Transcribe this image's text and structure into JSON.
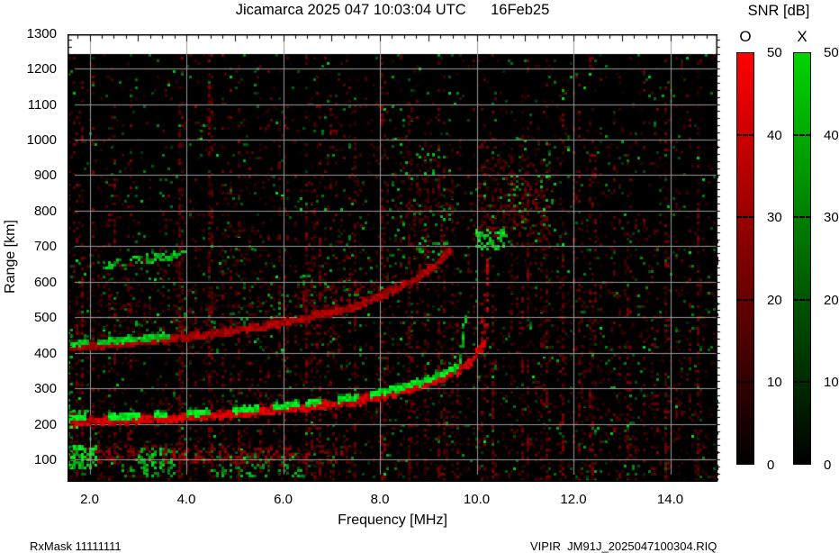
{
  "title": "Jicamarca 2025 047 10:03:04 UTC      16Feb25",
  "footer": {
    "left": "RxMask 11111111",
    "right": "VIPIR  JM91J_2025047100304.RIQ"
  },
  "colorbar": {
    "title": "SNR [dB]",
    "tick_values": [
      0,
      10,
      20,
      30,
      40,
      50
    ],
    "tick_labels": [
      "0",
      "10",
      "20",
      "30",
      "40",
      "50"
    ],
    "bars": [
      {
        "label": "O",
        "top_color": "#ff0000",
        "bottom_color": "#000000"
      },
      {
        "label": "X",
        "top_color": "#00d400",
        "bottom_color": "#000000"
      }
    ]
  },
  "chart_data": {
    "type": "heatmap",
    "title": "Jicamarca 2025 047 10:03:04 UTC      16Feb25",
    "xlabel": "Frequency [MHz]",
    "ylabel": "Range [km]",
    "xlim": [
      1.5,
      15.0
    ],
    "ylim": [
      40,
      1300
    ],
    "grid": true,
    "grid_color": "#9a9a9a",
    "x_tick_values": [
      2,
      4,
      6,
      8,
      10,
      12,
      14
    ],
    "x_tick_labels": [
      "2.0",
      "4.0",
      "6.0",
      "8.0",
      "10.0",
      "12.0",
      "14.0"
    ],
    "y_tick_values": [
      100,
      200,
      300,
      400,
      500,
      600,
      700,
      800,
      900,
      1000,
      1100,
      1200,
      1300
    ],
    "y_tick_labels": [
      "100",
      "200",
      "300",
      "400",
      "500",
      "600",
      "700",
      "800",
      "900",
      "1000",
      "1100",
      "1200",
      "1300"
    ],
    "snr_scale_db": [
      0,
      50
    ],
    "modes": {
      "O": "red",
      "X": "green"
    },
    "data_max_range_km": 1240,
    "traces": [
      {
        "name": "F2 main echo O-mode",
        "mode": "O",
        "thickness_km": 17,
        "brightness": 1.0,
        "points": [
          [
            1.5,
            205
          ],
          [
            2.5,
            210
          ],
          [
            3.5,
            216
          ],
          [
            4.5,
            223
          ],
          [
            5.5,
            234
          ],
          [
            6.5,
            248
          ],
          [
            7.5,
            264
          ],
          [
            8.2,
            284
          ],
          [
            8.8,
            306
          ],
          [
            9.2,
            325
          ],
          [
            9.6,
            350
          ],
          [
            9.9,
            378
          ],
          [
            10.05,
            405
          ],
          [
            10.18,
            438
          ]
        ],
        "segments": [
          [
            1.5,
            10.18
          ]
        ]
      },
      {
        "name": "F2 main echo X-mode",
        "mode": "X",
        "thickness_km": 12,
        "brightness": 1.0,
        "offset_km": 11,
        "points": [
          [
            1.5,
            205
          ],
          [
            2.5,
            210
          ],
          [
            3.5,
            216
          ],
          [
            4.5,
            223
          ],
          [
            5.5,
            234
          ],
          [
            6.5,
            248
          ],
          [
            7.5,
            264
          ],
          [
            8.2,
            284
          ],
          [
            8.8,
            306
          ],
          [
            9.2,
            325
          ],
          [
            9.6,
            350
          ],
          [
            9.9,
            378
          ]
        ],
        "segments": [
          [
            1.5,
            1.95
          ],
          [
            2.4,
            3.05
          ],
          [
            3.35,
            3.62
          ],
          [
            4.05,
            4.5
          ],
          [
            4.95,
            5.5
          ],
          [
            5.8,
            6.32
          ],
          [
            6.5,
            6.78
          ],
          [
            7.15,
            7.55
          ],
          [
            7.8,
            9.62
          ]
        ]
      },
      {
        "name": "2F second-hop echo O-mode",
        "mode": "O",
        "thickness_km": 15,
        "brightness": 0.8,
        "points": [
          [
            1.5,
            415
          ],
          [
            2.5,
            424
          ],
          [
            3.5,
            436
          ],
          [
            4.5,
            452
          ],
          [
            5.5,
            472
          ],
          [
            6.5,
            498
          ],
          [
            7.5,
            530
          ],
          [
            8.2,
            570
          ],
          [
            8.8,
            614
          ],
          [
            9.2,
            652
          ],
          [
            9.45,
            688
          ]
        ],
        "segments": [
          [
            1.5,
            9.45
          ]
        ]
      },
      {
        "name": "2F second-hop echo X-mode",
        "mode": "X",
        "thickness_km": 11,
        "brightness": 0.9,
        "offset_km": 10,
        "points": [
          [
            1.5,
            415
          ],
          [
            2.5,
            424
          ],
          [
            3.5,
            436
          ],
          [
            4.5,
            452
          ],
          [
            5.5,
            472
          ],
          [
            6.5,
            498
          ]
        ],
        "segments": [
          [
            1.6,
            1.95
          ],
          [
            2.2,
            3.65
          ]
        ]
      }
    ],
    "vertical_dashes": [
      {
        "f": 10.22,
        "r": [
          440,
          665
        ],
        "mode": "O",
        "p": 0.5
      },
      {
        "f": 10.12,
        "r": [
          400,
          525
        ],
        "mode": "O",
        "p": 0.35
      },
      {
        "f": 9.58,
        "r": [
          340,
          395
        ],
        "mode": "X",
        "p": 0.4
      },
      {
        "f": 9.66,
        "r": [
          360,
          432
        ],
        "mode": "X",
        "p": 0.5
      },
      {
        "f": 9.74,
        "r": [
          420,
          505
        ],
        "mode": "X",
        "p": 0.5
      }
    ],
    "patches": [
      {
        "name": "E-region echo band",
        "f": [
          1.5,
          7.6
        ],
        "r": [
          85,
          135
        ],
        "density": 0.55,
        "red": [
          60,
          180
        ],
        "green_p": 0.03,
        "green": [
          80,
          180
        ],
        "fade": true
      },
      {
        "name": "E-region X blob",
        "f": [
          1.5,
          2.12
        ],
        "r": [
          80,
          142
        ],
        "density": 0.08,
        "red": [
          60,
          140
        ],
        "green_p": 0.55,
        "green": [
          150,
          255
        ]
      },
      {
        "name": "E green patch",
        "f": [
          3.05,
          3.72
        ],
        "r": [
          80,
          132
        ],
        "density": 0.0,
        "red": [
          0,
          0
        ],
        "green_p": 0.38,
        "green": [
          120,
          230
        ]
      },
      {
        "name": "sporadic green below E",
        "f": [
          4.55,
          6.5
        ],
        "r": [
          55,
          108
        ],
        "density": 0.05,
        "red": [
          30,
          90
        ],
        "green_p": 0.2,
        "green": [
          90,
          200
        ]
      },
      {
        "name": "green below E left",
        "f": [
          2.7,
          3.8
        ],
        "r": [
          50,
          95
        ],
        "density": 0.03,
        "red": [
          30,
          80
        ],
        "green_p": 0.22,
        "green": [
          90,
          200
        ]
      },
      {
        "name": "F start X blob",
        "f": [
          1.5,
          1.95
        ],
        "r": [
          188,
          238
        ],
        "density": 0.1,
        "red": [
          80,
          180
        ],
        "green_p": 0.6,
        "green": [
          170,
          255
        ]
      },
      {
        "name": "left edge column",
        "f": [
          1.5,
          1.66
        ],
        "r": [
          60,
          470
        ],
        "density": 0.12,
        "red": [
          40,
          110
        ],
        "green_p": 0.3,
        "green": [
          100,
          220
        ]
      },
      {
        "name": "inter-hop spread low",
        "f": [
          1.8,
          6.35
        ],
        "r": [
          452,
          598
        ],
        "density": 0.14,
        "red": [
          25,
          95
        ],
        "green_p": 0.02,
        "green": [
          70,
          160
        ],
        "fade": true
      },
      {
        "name": "3F region spread",
        "f": [
          2.0,
          5.6
        ],
        "r": [
          598,
          705
        ],
        "density": 0.11,
        "red": [
          25,
          85
        ],
        "green_p": 0.025,
        "green": [
          70,
          170
        ],
        "fade": true
      },
      {
        "name": "patch above 3F",
        "f": [
          4.3,
          5.45
        ],
        "r": [
          690,
          772
        ],
        "density": 0.1,
        "red": [
          25,
          90
        ],
        "green_p": 0.02,
        "green": [
          70,
          160
        ],
        "fade": true
      },
      {
        "name": "spread-F column mid",
        "f": [
          8.28,
          9.55
        ],
        "r": [
          660,
          1012
        ],
        "density": 0.16,
        "red": [
          28,
          110
        ],
        "green_p": 0.05,
        "green": [
          90,
          210
        ],
        "fade": true
      },
      {
        "name": "spread-F patch right",
        "f": [
          9.98,
          11.62
        ],
        "r": [
          688,
          942
        ],
        "density": 0.3,
        "red": [
          35,
          130
        ],
        "green_p": 0.06,
        "green": [
          90,
          210
        ],
        "fade": true
      },
      {
        "name": "right patch green blob",
        "f": [
          10.0,
          10.58
        ],
        "r": [
          692,
          748
        ],
        "density": 0.05,
        "red": [
          40,
          110
        ],
        "green_p": 0.5,
        "green": [
          150,
          255
        ]
      },
      {
        "name": "right patch high tail",
        "f": [
          10.5,
          11.62
        ],
        "r": [
          942,
          1010
        ],
        "density": 0.07,
        "red": [
          25,
          80
        ],
        "green_p": 0.04,
        "green": [
          80,
          180
        ],
        "fade": true
      }
    ],
    "bands": [
      {
        "name": "3F green streak",
        "points": [
          [
            2.3,
            636
          ],
          [
            3.0,
            652
          ],
          [
            3.95,
            670
          ]
        ],
        "width_km": 22,
        "density": 0.4,
        "red": [
          40,
          110
        ],
        "green_p": 0.5,
        "green": [
          110,
          230
        ]
      },
      {
        "name": "2F spread cloud",
        "points": [
          [
            6.3,
            505
          ],
          [
            7.2,
            528
          ],
          [
            8.0,
            552
          ],
          [
            8.6,
            582
          ],
          [
            9.0,
            618
          ],
          [
            9.4,
            660
          ]
        ],
        "width_km": 110,
        "density": 0.35,
        "red": [
          40,
          140
        ],
        "green_p": 0.03,
        "green": [
          90,
          200
        ]
      },
      {
        "name": "2F cloud low",
        "points": [
          [
            1.6,
            428
          ],
          [
            3.0,
            440
          ],
          [
            4.5,
            458
          ],
          [
            5.8,
            478
          ],
          [
            6.3,
            490
          ]
        ],
        "width_km": 55,
        "density": 0.18,
        "red": [
          30,
          100
        ],
        "green_p": 0.03,
        "green": [
          80,
          180
        ]
      }
    ],
    "rfi_columns": [
      {
        "f": 1.72,
        "r_top": 600,
        "s": 0.4
      },
      {
        "f": 2.2,
        "r_top": 700,
        "s": 0.5
      },
      {
        "f": 3.85,
        "r_top": 1100,
        "s": 0.65
      },
      {
        "f": 4.5,
        "r_top": 1240,
        "s": 0.85
      },
      {
        "f": 5.95,
        "r_top": 1050,
        "s": 0.6
      },
      {
        "f": 6.62,
        "r_top": 900,
        "s": 0.5
      },
      {
        "f": 7.5,
        "r_top": 1100,
        "s": 0.6
      },
      {
        "f": 8.05,
        "r_top": 1240,
        "s": 0.7
      },
      {
        "f": 8.62,
        "r_top": 1100,
        "s": 0.65
      },
      {
        "f": 8.95,
        "r_top": 1000,
        "s": 0.6
      },
      {
        "f": 9.5,
        "r_top": 900,
        "s": 0.5
      },
      {
        "f": 10.7,
        "r_top": 950,
        "s": 0.45
      },
      {
        "f": 11.32,
        "r_top": 900,
        "s": 0.55
      },
      {
        "f": 12.15,
        "r_top": 800,
        "s": 0.35
      },
      {
        "f": 13.05,
        "r_top": 750,
        "s": 0.3
      },
      {
        "f": 14.2,
        "r_top": 700,
        "s": 0.3
      }
    ],
    "noise": {
      "base_density": 0.32,
      "green_p": 0.014,
      "bright_green_p": 0.004
    }
  }
}
